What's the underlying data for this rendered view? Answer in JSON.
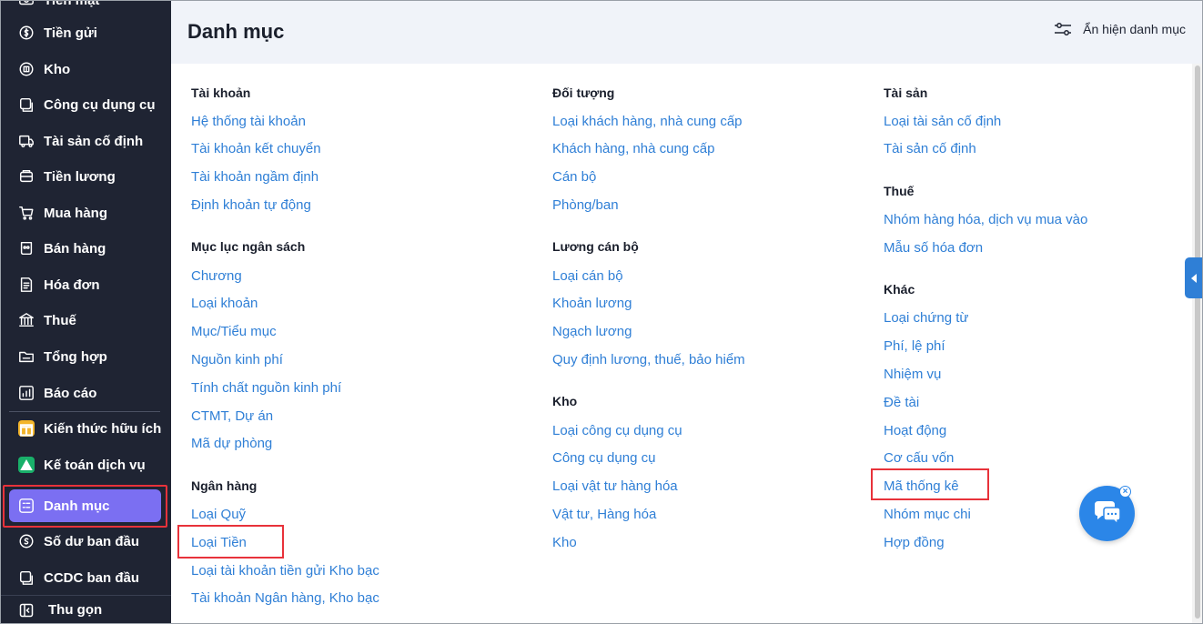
{
  "sidebar": {
    "partial_top_label": "Tiền mặt",
    "items": [
      {
        "label": "Tiền gửi",
        "icon": "coin-icon"
      },
      {
        "label": "Kho",
        "icon": "box-icon"
      },
      {
        "label": "Công cụ dụng cụ",
        "icon": "tools-icon"
      },
      {
        "label": "Tài sản cố định",
        "icon": "truck-icon"
      },
      {
        "label": "Tiền lương",
        "icon": "wallet-icon"
      },
      {
        "label": "Mua hàng",
        "icon": "cart-icon"
      },
      {
        "label": "Bán hàng",
        "icon": "shop-icon"
      },
      {
        "label": "Hóa đơn",
        "icon": "invoice-icon"
      },
      {
        "label": "Thuế",
        "icon": "bank-icon"
      },
      {
        "label": "Tổng hợp",
        "icon": "folder-icon"
      },
      {
        "label": "Báo cáo",
        "icon": "chart-icon"
      },
      {
        "label": "Kiến thức hữu ích",
        "icon": "gift-icon"
      },
      {
        "label": "Kế toán dịch vụ",
        "icon": "service-icon"
      },
      {
        "label": "Danh mục",
        "icon": "list-icon"
      },
      {
        "label": "Số dư ban đầu",
        "icon": "balance-icon"
      },
      {
        "label": "CCDC ban đầu",
        "icon": "tools-start-icon"
      }
    ],
    "active_index": 13,
    "collapse_label": "Thu gọn",
    "active_color": "#7b6ff2",
    "bg_color": "#1f2433"
  },
  "header": {
    "title": "Danh mục",
    "toggle_label": "Ẩn hiện danh mục"
  },
  "columns": [
    {
      "groups": [
        {
          "title": "Tài khoản",
          "links": [
            "Hệ thống tài khoản",
            "Tài khoản kết chuyển",
            "Tài khoản ngầm định",
            "Định khoản tự động"
          ]
        },
        {
          "title": "Mục lục ngân sách",
          "links": [
            "Chương",
            "Loại khoản",
            "Mục/Tiểu mục",
            "Nguồn kinh phí",
            "Tính chất nguồn kinh phí",
            "CTMT, Dự án",
            "Mã dự phòng"
          ]
        },
        {
          "title": "Ngân hàng",
          "links": [
            "Loại Quỹ",
            "Loại Tiền",
            "Loại tài khoản tiền gửi Kho bạc",
            "Tài khoản Ngân hàng, Kho bạc"
          ]
        }
      ]
    },
    {
      "groups": [
        {
          "title": "Đối tượng",
          "links": [
            "Loại khách hàng, nhà cung cấp",
            "Khách hàng, nhà cung cấp",
            "Cán bộ",
            "Phòng/ban"
          ]
        },
        {
          "title": "Lương cán bộ",
          "links": [
            "Loại cán bộ",
            "Khoản lương",
            "Ngạch lương",
            "Quy định lương, thuế, bảo hiểm"
          ]
        },
        {
          "title": "Kho",
          "links": [
            "Loại công cụ dụng cụ",
            "Công cụ dụng cụ",
            "Loại vật tư hàng hóa",
            "Vật tư, Hàng hóa",
            "Kho"
          ]
        }
      ]
    },
    {
      "groups": [
        {
          "title": "Tài sản",
          "links": [
            "Loại tài sản cố định",
            "Tài sản cố định"
          ]
        },
        {
          "title": "Thuế",
          "links": [
            "Nhóm hàng hóa, dịch vụ mua vào",
            "Mẫu số hóa đơn"
          ]
        },
        {
          "title": "Khác",
          "links": [
            "Loại chứng từ",
            "Phí, lệ phí",
            "Nhiệm vụ",
            "Đề tài",
            "Hoạt động",
            "Cơ cấu vốn",
            "Mã thống kê",
            "Nhóm mục chi",
            "Hợp đồng"
          ]
        }
      ]
    }
  ],
  "colors": {
    "link": "#2f7fd6",
    "highlight": "#e8323a",
    "header_bg": "#f0f3f9",
    "chat": "#2b86e8"
  }
}
